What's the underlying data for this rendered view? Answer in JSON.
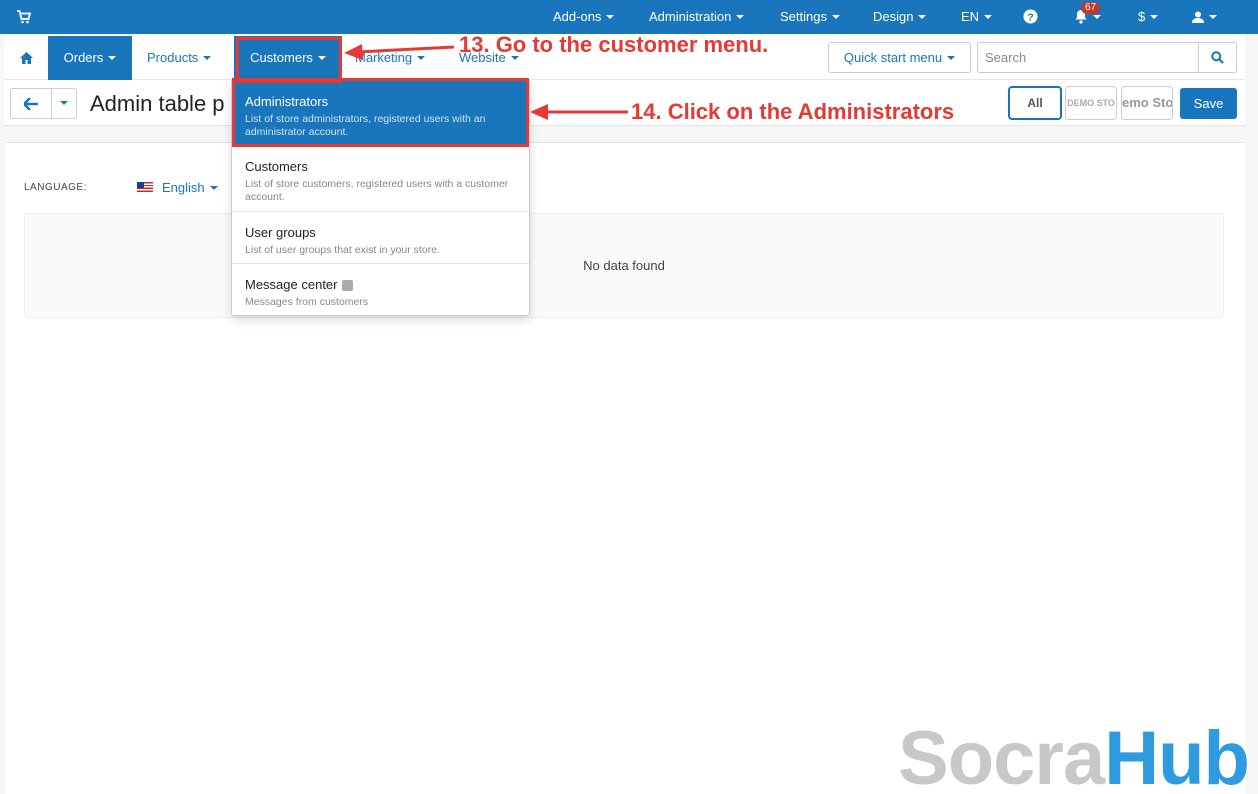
{
  "topbar": {
    "addons": "Add-ons",
    "administration": "Administration",
    "settings": "Settings",
    "design": "Design",
    "language": "EN",
    "notifications_count": "67",
    "currency": "$"
  },
  "nav": {
    "orders": "Orders",
    "products": "Products",
    "customers": "Customers",
    "marketing": "Marketing",
    "website": "Website",
    "quick_start": "Quick start menu",
    "search_placeholder": "Search"
  },
  "toolbar": {
    "page_title": "Admin table p",
    "all": "All",
    "store1": "DEMO STO",
    "store2": "emo Sto",
    "save": "Save"
  },
  "content": {
    "language_label": "LANGUAGE:",
    "language_value": "English",
    "no_data": "No data found"
  },
  "dropdown": {
    "items": [
      {
        "title": "Administrators",
        "desc": "List of store administrators, registered users with an administrator account."
      },
      {
        "title": "Customers",
        "desc": "List of store customers, registered users with a customer account."
      },
      {
        "title": "User groups",
        "desc": "List of user groups that exist in your store."
      },
      {
        "title": "Message center",
        "desc": "Messages from customers"
      }
    ]
  },
  "annotations": {
    "step13": "13. Go to the customer menu.",
    "step14": "14.  Click on the Administrators"
  },
  "watermark": {
    "part1": "Socra",
    "part2": "Hub"
  },
  "colors": {
    "primary": "#1976bc",
    "annotation": "#e53935"
  }
}
